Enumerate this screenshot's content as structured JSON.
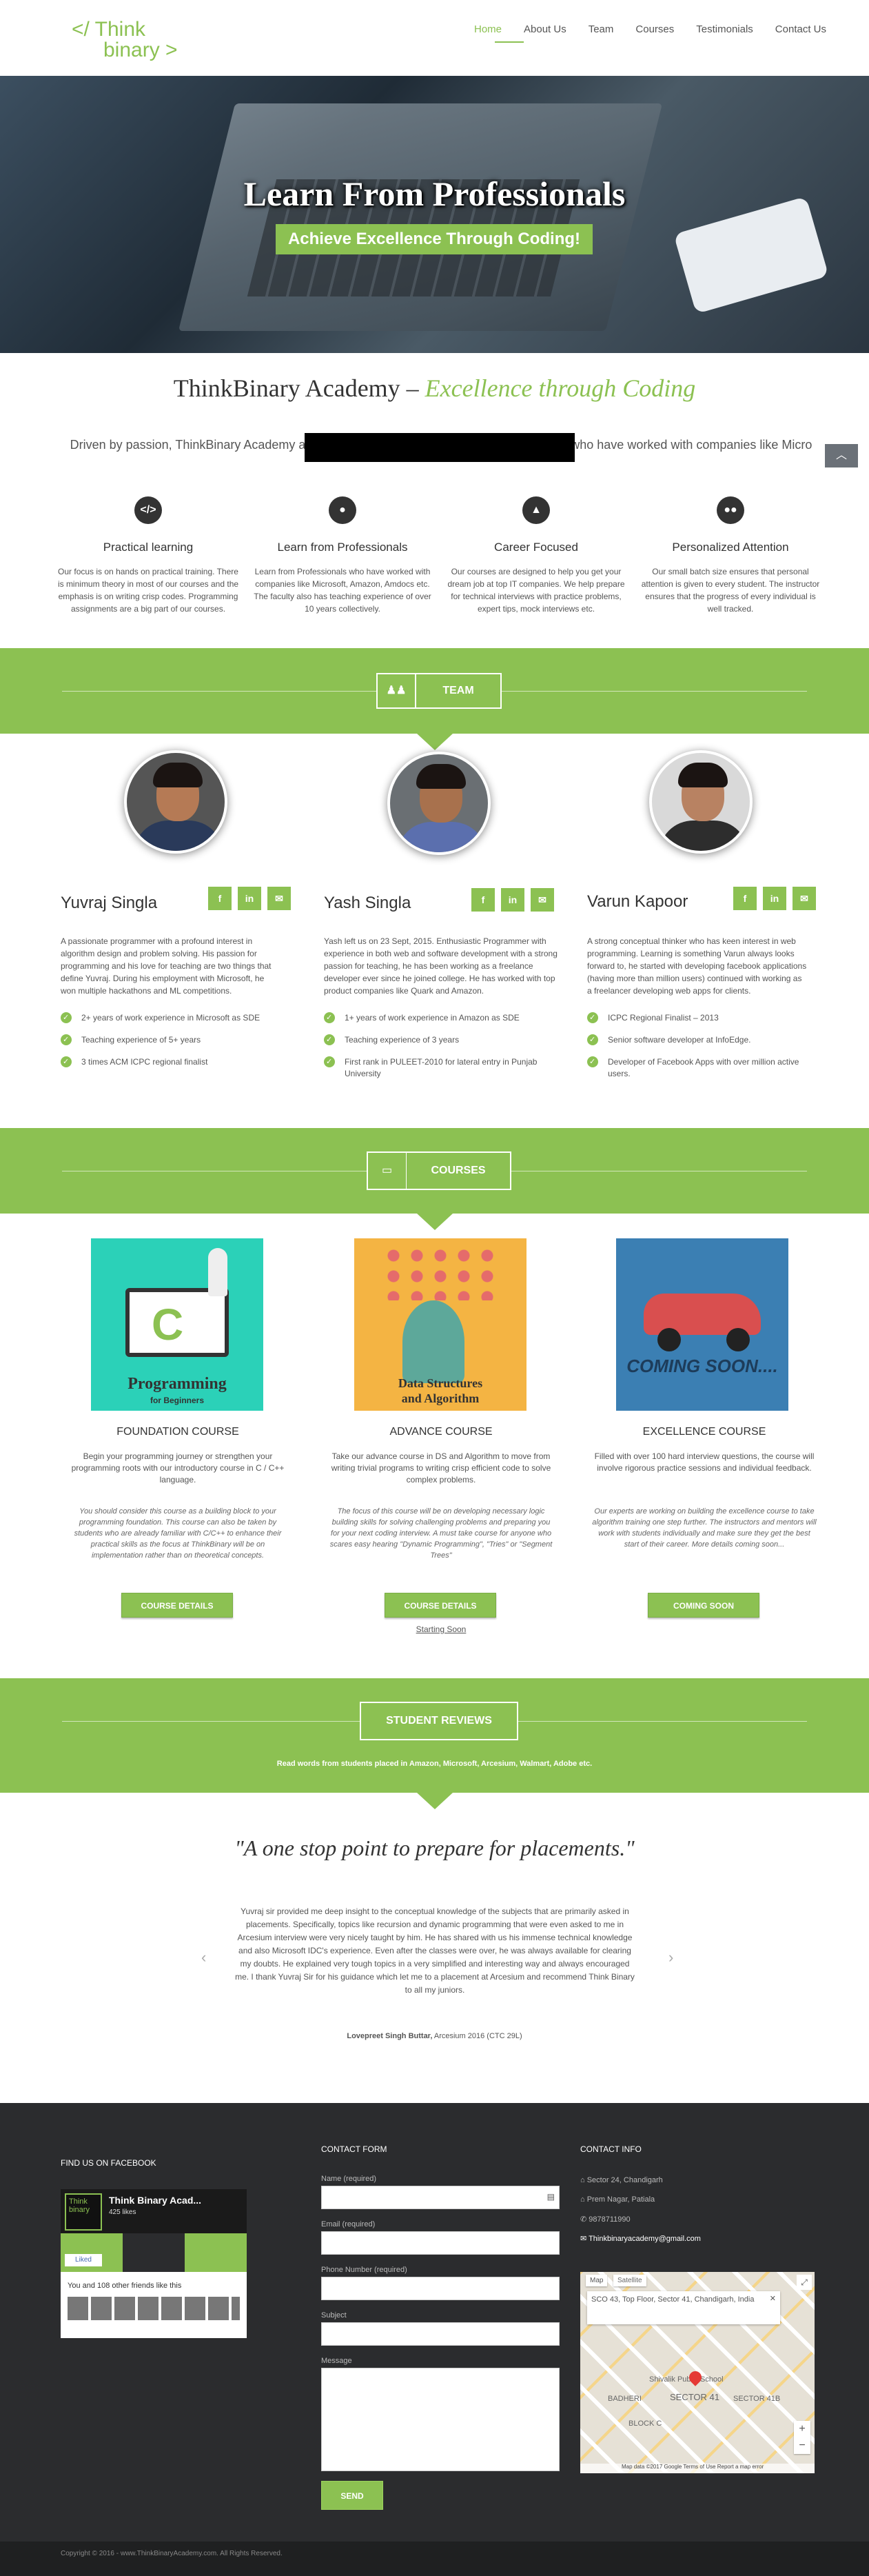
{
  "header": {
    "logo_line1": "</ Think",
    "logo_line2": "binary >",
    "nav": [
      "Home",
      "About Us",
      "Team",
      "Courses",
      "Testimonials",
      "Contact Us"
    ]
  },
  "hero": {
    "title": "Learn From Professionals",
    "tagline": "Achieve Excellence Through Coding!"
  },
  "academy": {
    "title_plain": "ThinkBinary Academy – ",
    "title_em": "Excellence through Coding",
    "intro": "Driven by passion, ThinkBinary Academy aim                                                                            coding. The academy is run by professionals who have worked with companies like Micro                                                             as passionate about learning as we are about",
    "scroll_top_icon": "chevron-up-icon",
    "features": [
      {
        "icon": "code-icon",
        "glyph": "</>",
        "title": "Practical learning",
        "text": "Our focus is on hands on practical training. There is minimum theory in most of our courses and the emphasis is on writing crisp codes. Programming assignments are a big part of our courses."
      },
      {
        "icon": "user-icon",
        "glyph": "●",
        "title": "Learn from Professionals",
        "text": "Learn from Professionals who have worked with companies like Microsoft, Amazon, Amdocs etc. The faculty also has teaching experience of over 10 years collectively."
      },
      {
        "icon": "graduation-cap-icon",
        "glyph": "▲",
        "title": "Career Focused",
        "text": "Our courses are designed to help you get your dream job at top IT companies. We help prepare for technical interviews with practice problems, expert tips, mock interviews etc."
      },
      {
        "icon": "chat-icon",
        "glyph": "●●",
        "title": "Personalized Attention",
        "text": "Our small batch size ensures that personal attention is given to every student. The instructor ensures that the progress of every individual is well tracked."
      }
    ]
  },
  "team": {
    "heading": "TEAM",
    "icon": "users-icon",
    "members": [
      {
        "name": "Yuvraj Singla",
        "bio": "A passionate programmer with a profound interest in algorithm design and problem solving. His passion for programming and his love for teaching are two things that define Yuvraj. During his employment with Microsoft, he won multiple hackathons and ML competitions.",
        "points": [
          "2+ years of work experience in Microsoft as SDE",
          "Teaching experience of 5+ years",
          "3 times ACM ICPC regional finalist"
        ]
      },
      {
        "name": "Yash Singla",
        "bio": "Yash left us on 23 Sept, 2015. Enthusiastic Programmer with experience in both web and software development with a strong passion for teaching, he has been working as a freelance developer ever since he joined college. He has worked with top product companies like Quark and Amazon.",
        "points": [
          "1+ years of work experience in Amazon as SDE",
          "Teaching experience of 3 years",
          "First rank in PULEET-2010 for lateral entry in Punjab University"
        ]
      },
      {
        "name": "Varun Kapoor",
        "bio": "A strong conceptual thinker who has keen interest in web programming. Learning is something Varun always looks forward to, he started with developing facebook applications (having more than million users) continued with working as a freelancer developing web apps for clients.",
        "points": [
          "ICPC Regional Finalist – 2013",
          "Senior software developer at InfoEdge.",
          "Developer of Facebook Apps with over million active users."
        ]
      }
    ],
    "social_icons": [
      "f",
      "in",
      "✉"
    ]
  },
  "courses": {
    "heading": "COURSES",
    "icon": "document-icon",
    "items": [
      {
        "title": "FOUNDATION COURSE",
        "image_caption": "Programming",
        "image_sub": "for Beginners",
        "desc": "Begin your programming journey or strengthen your programming roots with our introductory course in C / C++ language.",
        "desc_bold": "C / C++",
        "detail": "You should consider this course as a building block to your programming foundation. This course can also be taken by students who are already familiar with C/C++ to enhance their practical skills as the focus at ThinkBinary will be on implementation rather than on theoretical concepts.",
        "button": "COURSE DETAILS",
        "extra": ""
      },
      {
        "title": "ADVANCE COURSE",
        "image_caption": "Data Structures",
        "image_sub": "and Algorithm",
        "desc": "Take our advance course in DS and Algorithm to move from writing trivial programs to writing crisp efficient code to solve complex problems.",
        "detail": "The focus of this course will be on developing necessary logic building skills for solving challenging problems and preparing you for your next coding interview. A must take course for anyone who scares easy hearing \"Dynamic Programming\", \"Tries\" or \"Segment Trees\"",
        "button": "COURSE DETAILS",
        "extra": "Starting Soon"
      },
      {
        "title": "EXCELLENCE COURSE",
        "image_caption": "COMING SOON....",
        "image_sub": "",
        "desc": "Filled with over 100 hard interview questions, the course will involve rigorous practice sessions and individual feedback.",
        "detail": "Our experts are working on building the excellence course to take algorithm training one step further. The instructors and mentors will work with students individually and make sure they get the best start of their career. More details coming soon...",
        "button": "COMING SOON",
        "extra": ""
      }
    ]
  },
  "reviews": {
    "heading": "STUDENT REVIEWS",
    "subtitle": "Read words from students placed in Amazon, Microsoft, Arcesium, Walmart, Adobe etc.",
    "quote": "\"A one stop point to prepare for placements.\"",
    "text": "Yuvraj sir provided me deep insight to the conceptual knowledge of the subjects that are primarily asked in placements. Specifically, topics like recursion and dynamic programming that were even asked to me in Arcesium interview were very nicely taught by him. He has shared with us his immense technical knowledge and also Microsoft IDC's experience. Even after the classes were over, he was always available for clearing my doubts. He explained very tough topics in a very simplified and interesting way and always encouraged me. I thank Yuvraj Sir for his guidance which let me to a placement at Arcesium and recommend Think Binary to all my juniors.",
    "author": "Lovepreet Singh Buttar,",
    "author_detail": " Arcesium 2016 (CTC 29L)",
    "prev": "‹",
    "next": "›"
  },
  "footer": {
    "facebook_heading": "FIND US ON FACEBOOK",
    "fb_page_name": "Think Binary Acad...",
    "fb_likes": "425 likes",
    "fb_liked": "Liked",
    "fb_friends": "You and 108 other friends like this",
    "contact_heading": "CONTACT FORM",
    "fields": [
      {
        "label": "Name (required)"
      },
      {
        "label": "Email (required)"
      },
      {
        "label": "Phone Number (required)"
      },
      {
        "label": "Subject"
      },
      {
        "label": "Message"
      }
    ],
    "send": "SEND",
    "info_heading": "CONTACT INFO",
    "info": [
      "Sector 24, Chandigarh",
      "Prem Nagar, Patiala",
      "9878711990",
      "Thinkbinaryacademy@gmail.com"
    ],
    "map_tabs": [
      "Map",
      "Satellite"
    ],
    "map_address": "SCO 43, Top Floor, Sector 41, Chandigarh, India",
    "map_labels": [
      "SECTOR 41",
      "BADHERI",
      "SECTOR 41B",
      "BLOCK C",
      "Shivalik Public School"
    ],
    "map_footer": "Map data ©2017 Google   Terms of Use   Report a map error",
    "copyright": "Copyright © 2016 - www.ThinkBinaryAcademy.com. All Rights Reserved."
  },
  "colors": {
    "accent": "#8cc152",
    "dark": "#2b2c2e"
  }
}
